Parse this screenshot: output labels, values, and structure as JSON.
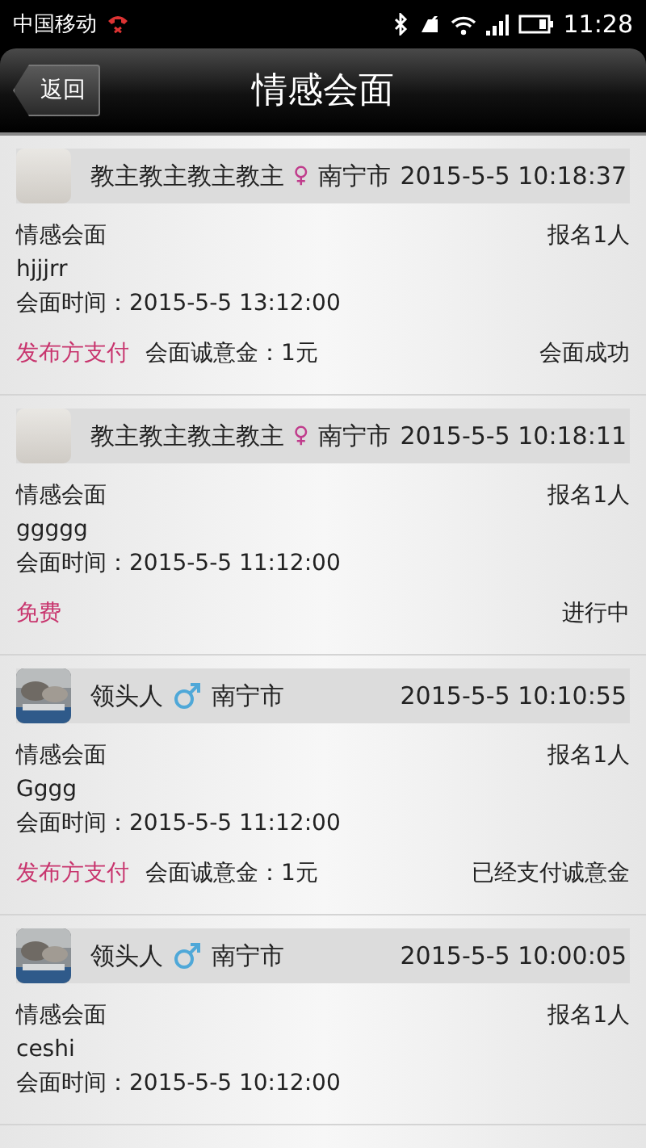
{
  "status_bar": {
    "carrier": "中国移动",
    "time": "11:28"
  },
  "header": {
    "back": "返回",
    "title": "情感会面"
  },
  "cards": [
    {
      "avatar": {
        "kind": "blank"
      },
      "name": "教主教主教主教主",
      "sex_icon": {
        "kind": "female"
      },
      "city": "南宁市",
      "posted": "2015-5-5 10:18:37",
      "type": "情感会面",
      "signups": "报名1人",
      "note": "hjjjrr",
      "meet_time": "会面时间：2015-5-5 13:12:00",
      "payer": "发布方支付",
      "deposit": "会面诚意金：1元",
      "status": "会面成功"
    },
    {
      "avatar": {
        "kind": "blank"
      },
      "name": "教主教主教主教主",
      "sex_icon": {
        "kind": "female"
      },
      "city": "南宁市",
      "posted": "2015-5-5 10:18:11",
      "type": "情感会面",
      "signups": "报名1人",
      "note": "ggggg",
      "meet_time": "会面时间：2015-5-5 11:12:00",
      "payer": "免费",
      "status": "进行中"
    },
    {
      "name": "领头人",
      "sex_icon": {
        "kind": "male"
      },
      "city": "南宁市",
      "posted": "2015-5-5 10:10:55",
      "type": "情感会面",
      "signups": "报名1人",
      "note": "Gggg",
      "meet_time": "会面时间：2015-5-5 11:12:00",
      "payer": "发布方支付",
      "deposit": "会面诚意金：1元",
      "status": "已经支付诚意金"
    },
    {
      "name": "领头人",
      "sex_icon": {
        "kind": "male"
      },
      "city": "南宁市",
      "posted": "2015-5-5 10:00:05",
      "type": "情感会面",
      "signups": "报名1人",
      "note": "ceshi",
      "meet_time": "会面时间：2015-5-5 10:12:00"
    }
  ]
}
